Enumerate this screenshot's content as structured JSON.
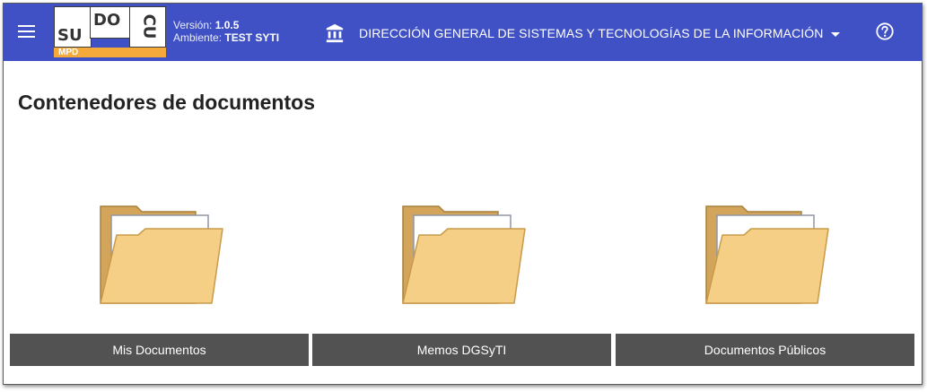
{
  "header": {
    "logo": {
      "su": "SU",
      "do": "DO",
      "cu": "CU",
      "mpd": "MPD"
    },
    "version_label": "Versión:",
    "version_value": "1.0.5",
    "environment_label": "Ambiente:",
    "environment_value": "TEST SYTI",
    "organization": "DIRECCIÓN GENERAL DE SISTEMAS Y TECNOLOGÍAS DE LA INFORMACIÓN",
    "icons": {
      "menu": "menu-icon",
      "org": "bank-icon",
      "help": "help-circle-icon"
    },
    "colors": {
      "bar": "#3f51c4",
      "logo_accent": "#f5a93a"
    }
  },
  "main": {
    "title": "Contenedores de documentos",
    "containers": [
      {
        "label": "Mis Documentos",
        "icon": "folder-icon"
      },
      {
        "label": "Memos DGSyTI",
        "icon": "folder-icon"
      },
      {
        "label": "Documentos Públicos",
        "icon": "folder-icon"
      }
    ],
    "colors": {
      "folder": "#f5cf86",
      "label_bg": "#525252"
    }
  }
}
